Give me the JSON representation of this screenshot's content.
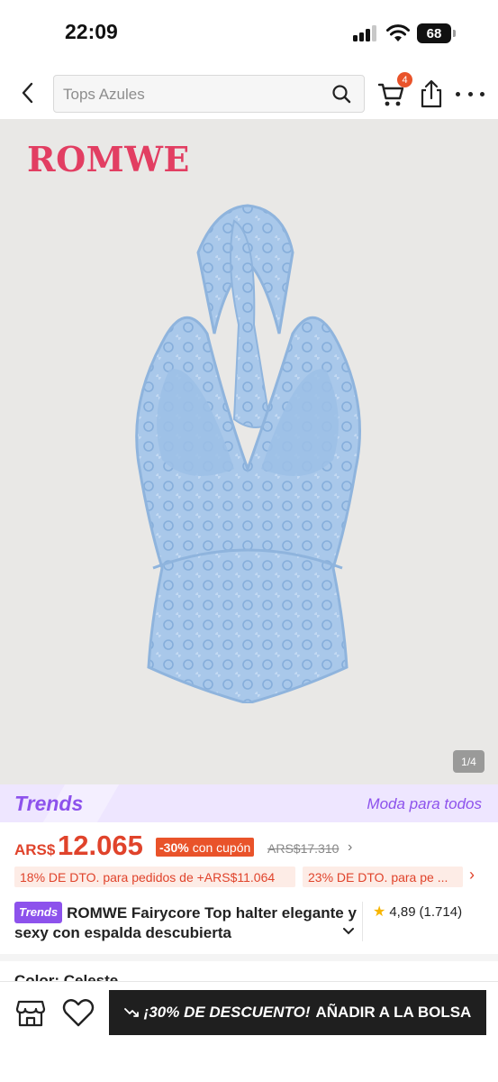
{
  "status_bar": {
    "time": "22:09",
    "battery": "68"
  },
  "header": {
    "search_placeholder": "Tops Azules",
    "cart_count": "4"
  },
  "gallery": {
    "brand": "ROMWE",
    "counter": "1/4"
  },
  "trends_banner": {
    "logo": "Trends",
    "tagline": "Moda para todos"
  },
  "price": {
    "currency": "ARS$",
    "amount": "12.065",
    "discount_pct": "-30%",
    "discount_note": "con cupón",
    "original": "ARS$17.310"
  },
  "promos": [
    {
      "text": "18% DE DTO. para pedidos de +ARS$11.064"
    },
    {
      "text": "23% DE DTO. para pe ..."
    }
  ],
  "product": {
    "trend_chip": "Trends",
    "title": "ROMWE Fairycore Top halter elegante y sexy con espalda descubierta",
    "rating": "4,89",
    "reviews": "(1.714)"
  },
  "color_label": "Color: Celeste",
  "bottom_bar": {
    "add_promo": "¡30% DE DESCUENTO!",
    "add_label": "AÑADIR A LA BOLSA"
  },
  "colors": {
    "accent": "#e0432b",
    "trends_purple": "#8d52ec",
    "brand_pink": "#e23e62",
    "garment_blue": "#9ebfe4"
  }
}
